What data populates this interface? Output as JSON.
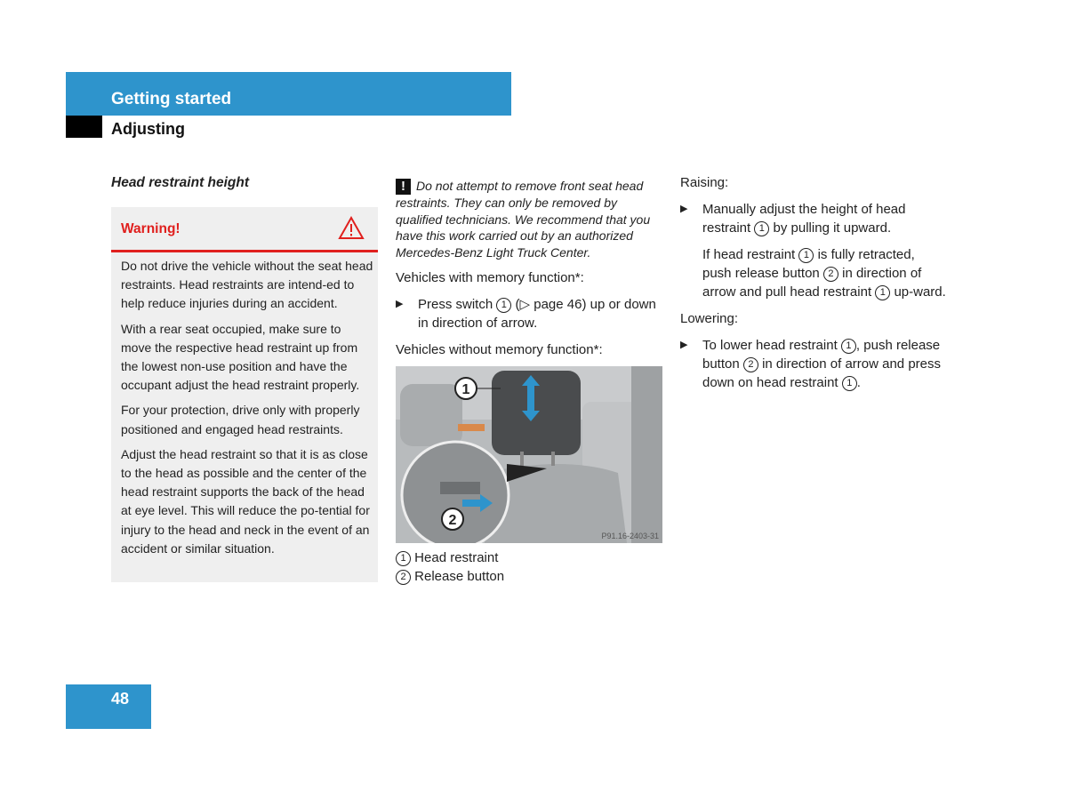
{
  "header": {
    "section": "Getting started",
    "subsection": "Adjusting"
  },
  "heading": "Head restraint height",
  "warning": {
    "title": "Warning!",
    "icon": "warning-triangle-icon",
    "color": "#e0201e",
    "paragraphs": [
      "Do not drive the vehicle without the seat head restraints. Head restraints are intend-ed to help reduce injuries during an accident.",
      "With a rear seat occupied, make sure to move the respective head restraint up from the lowest non-use position and have the occupant adjust the head restraint properly.",
      "For your protection, drive only with properly positioned and engaged head restraints.",
      "Adjust the head restraint so that it is as close to the head as possible and the center of the head restraint supports the back of the head at eye level. This will reduce the po-tential for injury to the head and neck in the event of an accident or similar situation."
    ]
  },
  "middle": {
    "note": "Do not attempt to remove front seat head restraints. They can only be removed by qualified technicians. We recommend that you have this work carried out by an authorized Mercedes-Benz Light Truck Center.",
    "memory_heading": "Vehicles with memory function*:",
    "memory_step": {
      "pre": "Press switch",
      "num": "1",
      "post": "(▷ page 46) up or down in direction of arrow."
    },
    "no_memory_heading": "Vehicles without memory function*:",
    "figure_code": "P91.16-2403-31",
    "legend": [
      {
        "num": "1",
        "label": "Head restraint"
      },
      {
        "num": "2",
        "label": "Release button"
      }
    ]
  },
  "right": {
    "raising": "Raising:",
    "raise_step": {
      "a": "Manually adjust the height of head restraint",
      "n1": "1",
      "b": "by pulling it upward."
    },
    "raise_note": {
      "a": "If head restraint",
      "n1": "1",
      "b": "is fully retracted, push release button",
      "n2": "2",
      "c": "in direction of arrow and pull head restraint",
      "n3": "1",
      "d": "up-ward."
    },
    "lowering": "Lowering:",
    "lower_step": {
      "a": "To lower head restraint",
      "n1": "1",
      "b": ", push release button",
      "n2": "2",
      "c": "in direction of arrow and press down on head restraint",
      "n3": "1",
      "d": "."
    }
  },
  "page_number": "48",
  "colors": {
    "brand_blue": "#2e94cc"
  }
}
